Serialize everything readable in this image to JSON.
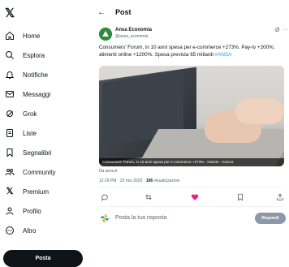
{
  "sidebar": {
    "logo": "𝕏",
    "items": [
      {
        "label": "Home",
        "icon": "home-icon"
      },
      {
        "label": "Esplora",
        "icon": "search-icon"
      },
      {
        "label": "Notifiche",
        "icon": "bell-icon"
      },
      {
        "label": "Messaggi",
        "icon": "mail-icon"
      },
      {
        "label": "Grok",
        "icon": "grok-icon"
      },
      {
        "label": "Liste",
        "icon": "list-icon"
      },
      {
        "label": "Segnalibri",
        "icon": "bookmark-icon"
      },
      {
        "label": "Community",
        "icon": "community-icon"
      },
      {
        "label": "Premium",
        "icon": "x-icon"
      },
      {
        "label": "Profilo",
        "icon": "profile-icon"
      },
      {
        "label": "Altro",
        "icon": "more-circle-icon"
      }
    ],
    "post_button": "Posta"
  },
  "header": {
    "title": "Post"
  },
  "post": {
    "author_name": "Ansa Economia",
    "author_handle": "@ansa_economia",
    "text_main": "Consumers' Forum, in 10 anni spesa per e-commerce +273%. Pay-tv +200%, alimenti online +1200%. Spesa prevista 65 miliardi ",
    "text_tag": "#ANSA",
    "image_caption": "Consumers' Forum, in 10 anni spesa per e-commerce +273% - Notizie - Ansa.it",
    "source": "Da ansa.it",
    "time": "12:29 PM · 23 nov 2025 · ",
    "views_count": "106",
    "views_label": " visualizzazioni"
  },
  "reply": {
    "placeholder": "Posta la tua risposta",
    "button": "Rispondi"
  },
  "colors": {
    "accent": "#1d9bf0",
    "like": "#f91880",
    "avatar_green": "#2e8a3e"
  }
}
